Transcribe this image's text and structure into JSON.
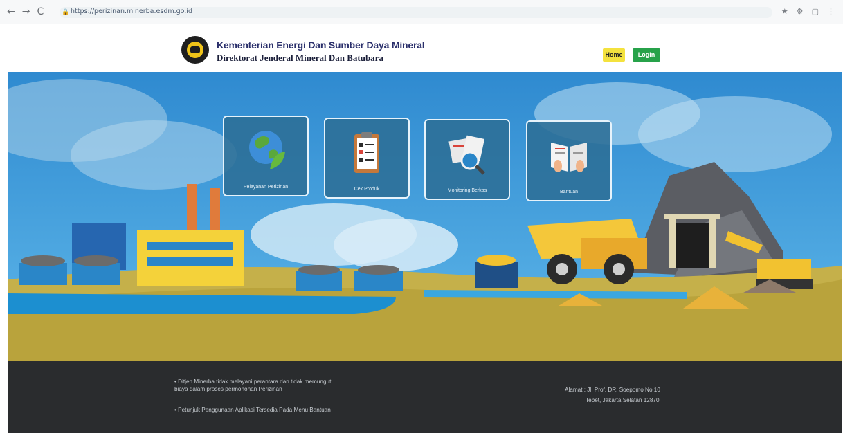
{
  "browser": {
    "url": "https://perizinan.minerba.esdm.go.id",
    "icons": [
      "back-icon",
      "forward-icon",
      "reload-icon",
      "lock-icon",
      "star-icon",
      "extension-icon",
      "menu-icon"
    ]
  },
  "header": {
    "org_line1": "Kementerian Energi Dan Sumber Daya Mineral",
    "org_line2": "Direktorat Jenderal Mineral Dan Batubara",
    "home_label": "Home",
    "login_label": "Login"
  },
  "tiles": [
    {
      "label": "Pelayanan Perizinan",
      "icon": "globe-leaf-icon"
    },
    {
      "label": "Cek Produk",
      "icon": "clipboard-checklist-icon"
    },
    {
      "label": "Monitoring Berkas",
      "icon": "documents-search-icon"
    },
    {
      "label": "Bantuan",
      "icon": "open-book-icon"
    }
  ],
  "footer": {
    "bullets": [
      "Ditjen Minerba tidak melayani perantara dan tidak memungut biaya dalam proses permohonan Perizinan",
      "Petunjuk Penggunaan Aplikasi Tersedia Pada Menu Bantuan"
    ],
    "address_line1": "Alamat : Jl. Prof. DR. Soepomo No.10",
    "address_line2": "Tebet, Jakarta Selatan 12870"
  },
  "colors": {
    "sky": "#3a9bd8",
    "ground": "#c5b04a",
    "water": "#1c8fd0",
    "footer": "#2a2c2e",
    "home_button": "#f4e23e",
    "login_button": "#27a24a"
  }
}
